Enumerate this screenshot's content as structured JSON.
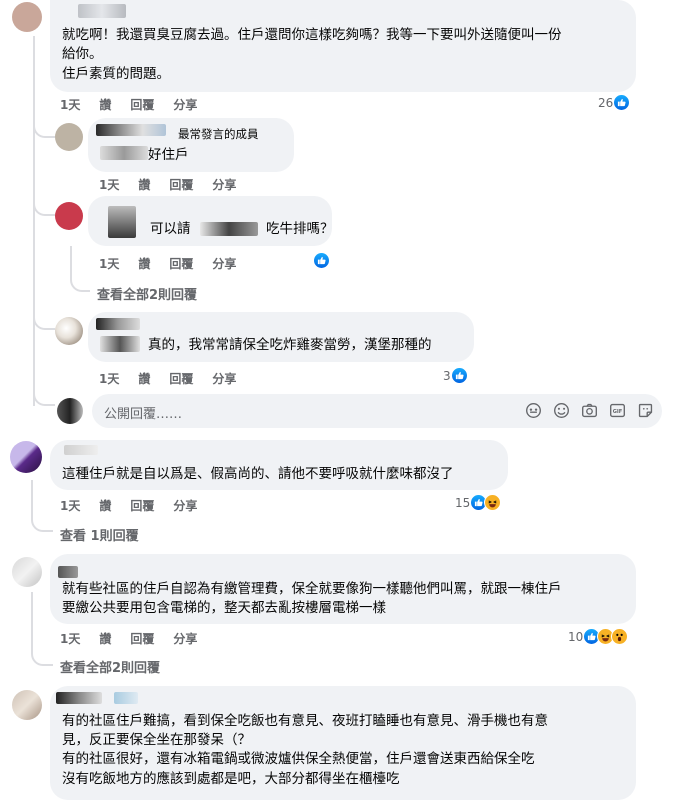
{
  "comments": [
    {
      "lines": [
        "就吃啊！我還買臭豆腐去過。住戶還問你這樣吃夠嗎？我等一下要叫外送隨便叫一份",
        "給你。",
        "住戶素質的問題。"
      ],
      "time": "1天",
      "like": "讚",
      "reply": "回覆",
      "share": "分享",
      "reactions": "26"
    },
    {
      "badge": "最常發言的成員",
      "text": "好住戶",
      "time": "1天",
      "like": "讚",
      "reply": "回覆",
      "share": "分享"
    },
    {
      "text_a": "可以請",
      "text_b": "吃牛排嗎？",
      "time": "1天",
      "like": "讚",
      "reply": "回覆",
      "share": "分享",
      "view_more": "查看全部2則回覆"
    },
    {
      "text": "真的，我常常請保全吃炸雞麥當勞，漢堡那種的",
      "time": "1天",
      "like": "讚",
      "reply": "回覆",
      "share": "分享",
      "reactions": "3"
    },
    {
      "text": "這種住戶就是自以爲是、假高尚的、請他不要呼吸就什麼味都沒了",
      "time": "1天",
      "like": "讚",
      "reply": "回覆",
      "share": "分享",
      "reactions": "15",
      "view_more": "查看 1則回覆"
    },
    {
      "lines": [
        "就有些社區的住戶自認為有繳管理費，保全就要像狗一樣聽他們叫罵，就跟一棟住戶",
        "要繳公共要用包含電梯的，整天都去亂按樓層電梯一樣"
      ],
      "time": "1天",
      "like": "讚",
      "reply": "回覆",
      "share": "分享",
      "reactions": "10",
      "view_more": "查看全部2則回覆"
    },
    {
      "lines": [
        "有的社區住戶難搞，看到保全吃飯也有意見、夜班打瞌睡也有意見、滑手機也有意",
        "見，反正要保全坐在那發呆（？",
        "有的社區很好，還有冰箱電鍋或微波爐供保全熱便當，住戶還會送東西給保全吃",
        "沒有吃飯地方的應該到處都是吧，大部分都得坐在櫃檯吃"
      ]
    }
  ],
  "reply_box": {
    "placeholder": "公開回覆……"
  },
  "colors": {
    "like_blue": "#1877f2",
    "bubble": "#f0f2f5",
    "meta": "#65676b"
  }
}
